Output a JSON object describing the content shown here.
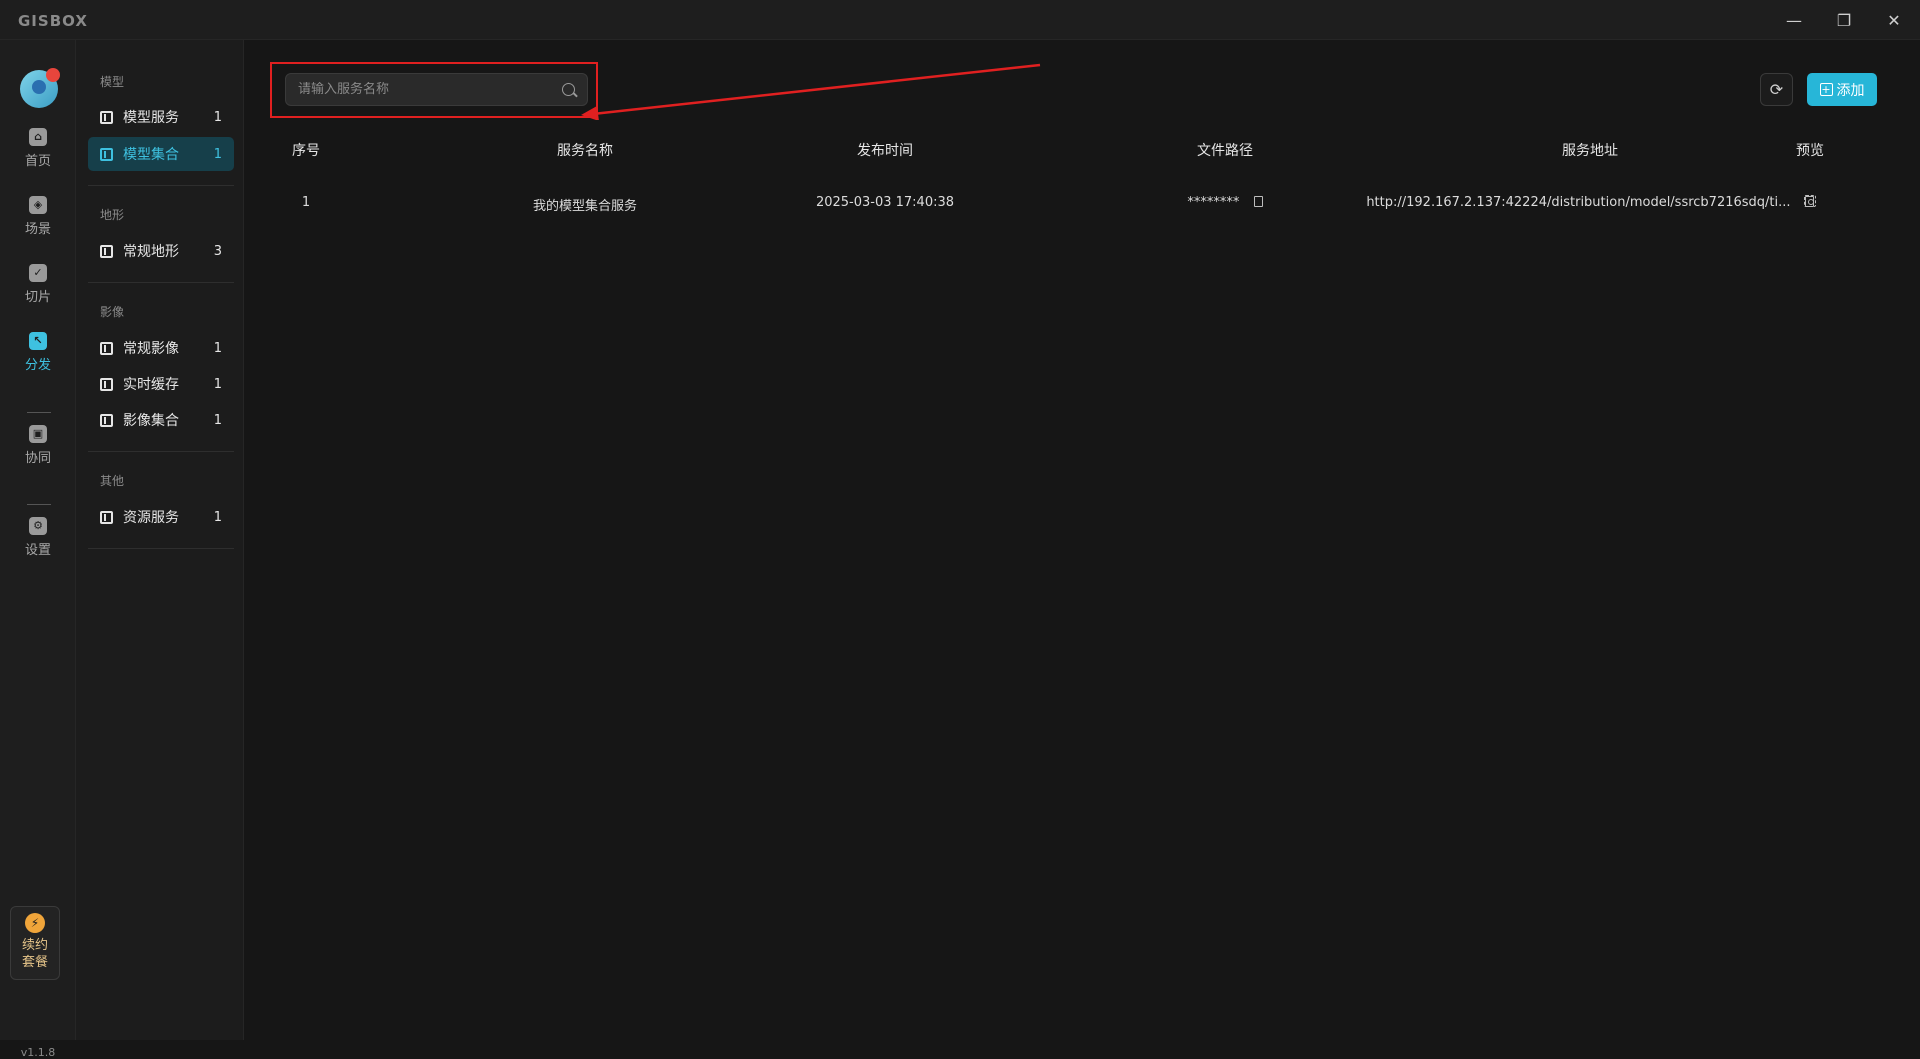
{
  "app": {
    "logo": "GISBOX",
    "window": {
      "minimize": "—",
      "restore": "❐",
      "close": "✕"
    }
  },
  "rail": {
    "items": [
      {
        "label": "首页",
        "icon": "home-icon"
      },
      {
        "label": "场景",
        "icon": "scene-icon"
      },
      {
        "label": "切片",
        "icon": "slice-icon"
      },
      {
        "label": "分发",
        "icon": "distribute-icon",
        "active": true
      },
      {
        "label": "协同",
        "icon": "lock-icon"
      },
      {
        "label": "设置",
        "icon": "gear-icon"
      }
    ],
    "renew": {
      "line1": "续约",
      "line2": "套餐"
    },
    "version": "v1.1.8"
  },
  "sidebar": {
    "groups": [
      {
        "title": "模型",
        "items": [
          {
            "label": "模型服务",
            "count": "1"
          },
          {
            "label": "模型集合",
            "count": "1",
            "active": true
          }
        ]
      },
      {
        "title": "地形",
        "items": [
          {
            "label": "常规地形",
            "count": "3"
          }
        ]
      },
      {
        "title": "影像",
        "items": [
          {
            "label": "常规影像",
            "count": "1"
          },
          {
            "label": "实时缓存",
            "count": "1"
          },
          {
            "label": "影像集合",
            "count": "1"
          }
        ]
      },
      {
        "title": "其他",
        "items": [
          {
            "label": "资源服务",
            "count": "1"
          }
        ]
      }
    ]
  },
  "toolbar": {
    "search_placeholder": "请输入服务名称",
    "add_label": "添加"
  },
  "table": {
    "headers": {
      "seq": "序号",
      "name": "服务名称",
      "time": "发布时间",
      "path": "文件路径",
      "url": "服务地址",
      "preview": "预览"
    },
    "rows": [
      {
        "seq": "1",
        "name": "我的模型集合服务",
        "time": "2025-03-03 17:40:38",
        "path": "********",
        "url": "http://192.167.2.137:42224/distribution/model/ssrcb7216sdq/ti..."
      }
    ]
  },
  "colors": {
    "accent": "#27b6d8",
    "highlight": "#e02020"
  }
}
